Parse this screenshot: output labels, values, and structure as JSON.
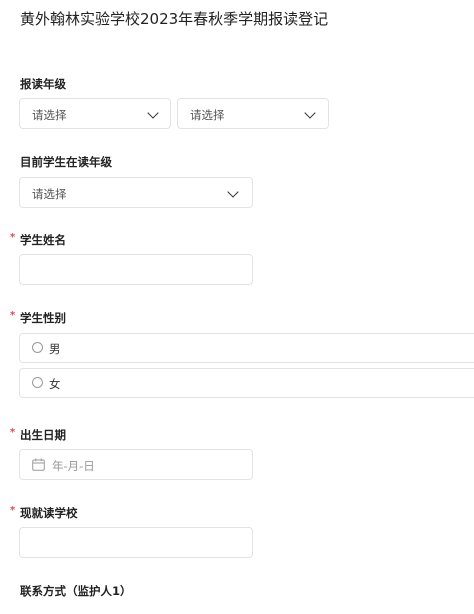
{
  "form": {
    "title": "黄外翰林实验学校2023年春秋季学期报读登记"
  },
  "fields": {
    "grade": {
      "label": "报读年级",
      "select1": "请选择",
      "select2": "请选择"
    },
    "current_grade": {
      "label": "目前学生在读年级",
      "select": "请选择"
    },
    "student_name": {
      "label": "学生姓名",
      "required": "*"
    },
    "gender": {
      "label": "学生性别",
      "required": "*",
      "options": [
        "男",
        "女"
      ]
    },
    "birth_date": {
      "label": "出生日期",
      "required": "*",
      "placeholder": "年-月-日"
    },
    "current_school": {
      "label": "现就读学校",
      "required": "*"
    },
    "contact": {
      "label": "联系方式（监护人1）"
    }
  }
}
